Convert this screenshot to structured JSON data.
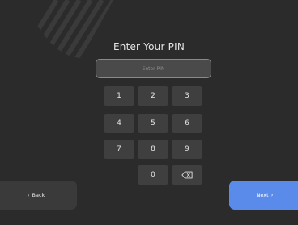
{
  "title": "Enter Your PIN",
  "pin_field": {
    "placeholder": "Enter PIN",
    "value": ""
  },
  "keypad": {
    "k1": "1",
    "k2": "2",
    "k3": "3",
    "k4": "4",
    "k5": "5",
    "k6": "6",
    "k7": "7",
    "k8": "8",
    "k9": "9",
    "k0": "0",
    "backspace_icon": "backspace-icon"
  },
  "buttons": {
    "back_label": "Back",
    "back_icon": "chevron-left-icon",
    "next_label": "Next",
    "next_icon": "chevron-right-icon"
  },
  "colors": {
    "background": "#2b2b2b",
    "key": "#3f3f3f",
    "accent": "#5b8bea"
  }
}
